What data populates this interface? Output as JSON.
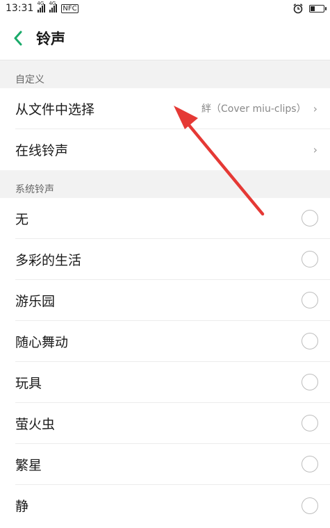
{
  "status_bar": {
    "time": "13:31",
    "signal1_tag": "4G",
    "signal2_tag": "4G",
    "nfc_label": "NFC"
  },
  "header": {
    "title": "铃声",
    "back_icon": "chevron-left-icon",
    "accent": "#1aaa6a"
  },
  "custom_section": {
    "title": "自定义",
    "items": [
      {
        "label": "从文件中选择",
        "value": "絆（Cover miu-clips）"
      },
      {
        "label": "在线铃声",
        "value": ""
      }
    ]
  },
  "system_section": {
    "title": "系统铃声",
    "items": [
      {
        "label": "无"
      },
      {
        "label": "多彩的生活"
      },
      {
        "label": "游乐园"
      },
      {
        "label": "随心舞动"
      },
      {
        "label": "玩具"
      },
      {
        "label": "萤火虫"
      },
      {
        "label": "繁星"
      },
      {
        "label": "静"
      }
    ]
  },
  "annotation": {
    "color": "#e53935"
  },
  "battery_level": 0.4
}
